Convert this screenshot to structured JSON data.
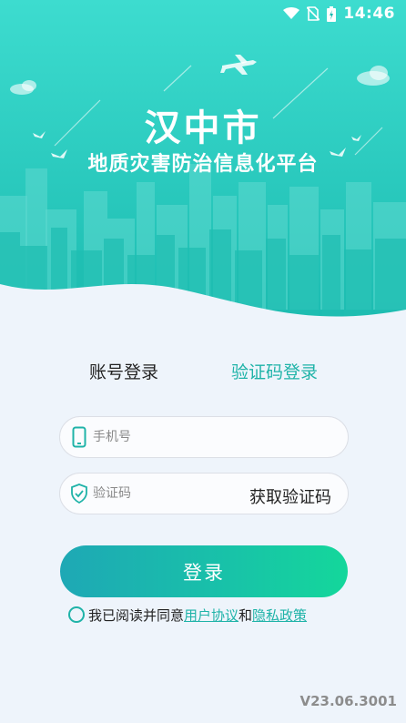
{
  "status_bar": {
    "time": "14:46",
    "icons": [
      "wifi-icon",
      "no-sim-icon",
      "battery-charging-icon"
    ]
  },
  "header": {
    "city": "汉中市",
    "subtitle": "地质灾害防治信息化平台"
  },
  "tabs": [
    {
      "label": "账号登录",
      "active": false
    },
    {
      "label": "验证码登录",
      "active": true
    }
  ],
  "form": {
    "phone_placeholder": "手机号",
    "code_placeholder": "验证码",
    "get_code_label": "获取验证码",
    "login_label": "登录"
  },
  "agreement": {
    "prefix": "我已阅读并同意",
    "user_agreement": "用户协议",
    "and": "和",
    "privacy_policy": "隐私政策",
    "checked": false
  },
  "version": "V23.06.3001",
  "colors": {
    "accent": "#1fb3a8",
    "hero_top": "#2ed8cf",
    "hero_bottom": "#16b6ad",
    "page_bg": "#eef4fb"
  }
}
